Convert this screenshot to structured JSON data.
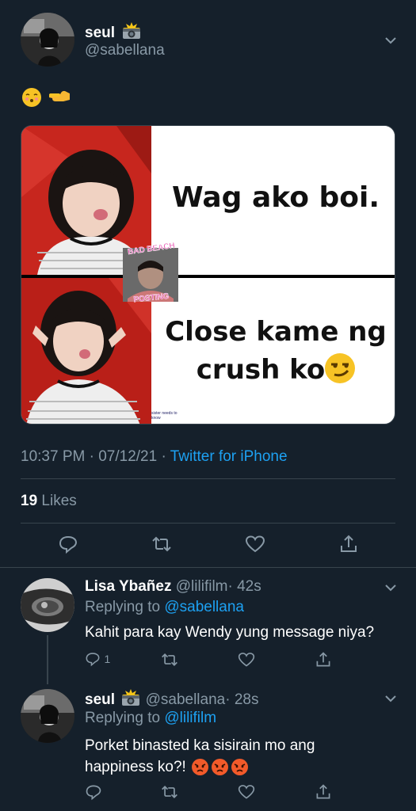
{
  "main_tweet": {
    "display_name": "seul",
    "name_emoji": "📸",
    "handle": "@sabellana",
    "emoji_text": "😚👈",
    "meme": {
      "top_text": "Wag ako boi.",
      "bottom_text_line1": "Close kame ng",
      "bottom_text_line2": "crush ko",
      "sticker_top": "BAD BEACH",
      "sticker_bottom": "POSTING",
      "watermark_line1": "sister needs to",
      "watermark_line2": "know"
    },
    "time": "10:37 PM · 07/12/21 · ",
    "source": "Twitter for iPhone",
    "likes_count": "19",
    "likes_label": " Likes"
  },
  "replies": [
    {
      "display_name": "Lisa Ybañez",
      "handle": "@lilifilm",
      "time": "· 42s",
      "replying_prefix": "Replying to ",
      "replying_to": "@sabellana",
      "text": "Kahit para kay Wendy yung message niya?",
      "reply_count": "1"
    },
    {
      "display_name": "seul",
      "name_emoji": "📸",
      "handle": "@sabellana",
      "time": "· 28s",
      "replying_prefix": "Replying to ",
      "replying_to": "@lilifilm",
      "text_line1": "Porket binasted ka sisirain mo ang",
      "text_line2": "happiness ko?!"
    }
  ],
  "icons": [
    "chevron-down-icon",
    "reply-icon",
    "retweet-icon",
    "like-icon",
    "share-icon",
    "camera-flash-icon"
  ],
  "colors": {
    "background": "#15202b",
    "muted": "#8899a6",
    "link": "#1da1f2",
    "divider": "#38444d"
  }
}
